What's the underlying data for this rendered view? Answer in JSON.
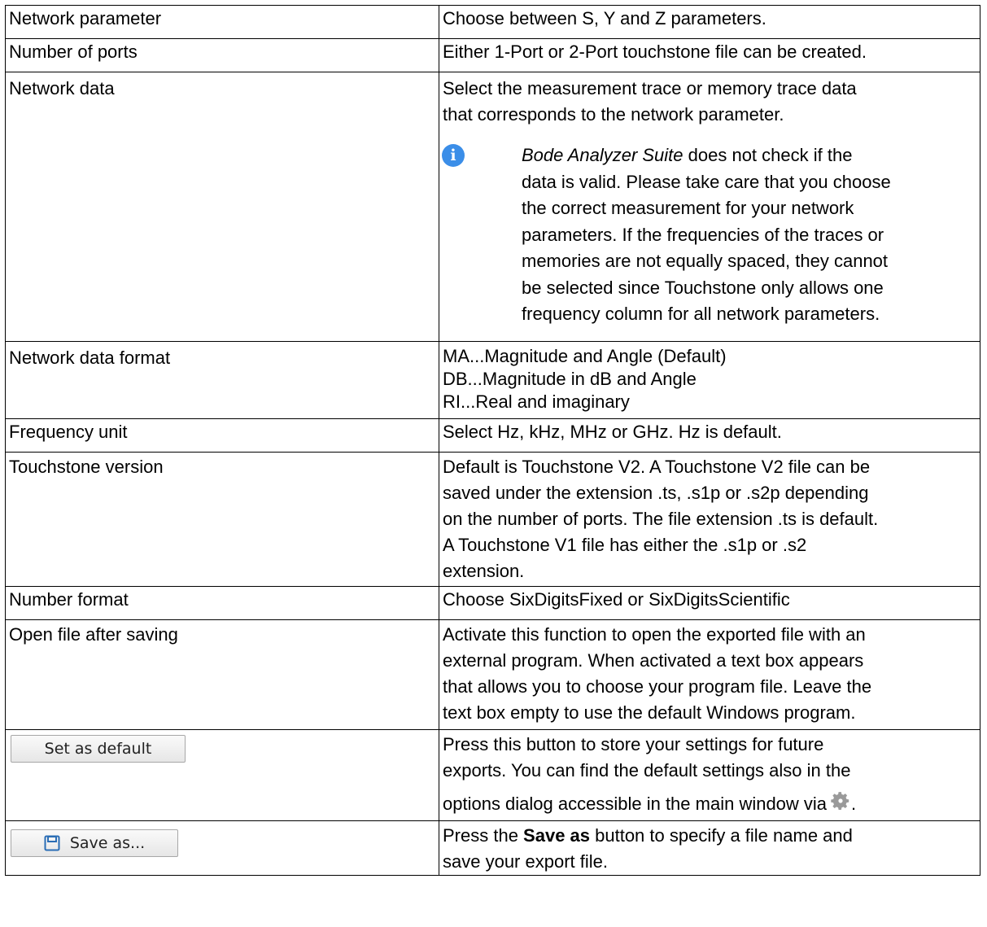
{
  "rows": [
    {
      "param": "Network parameter",
      "desc": "Choose between S, Y and Z parameters."
    },
    {
      "param": "Number of ports",
      "desc": "Either 1-Port or 2-Port touchstone file can be created."
    },
    {
      "param": "Network data",
      "desc_lines": [
        "Select the measurement trace or memory trace data",
        "that corresponds to the network parameter."
      ],
      "note": {
        "icon": "info-icon",
        "app_name": "Bode Analyzer Suite",
        "text_first": " does not check if the",
        "lines": [
          "data is valid. Please take care that you choose",
          "the correct measurement for your network",
          "parameters. If the frequencies of the traces or",
          "memories are not equally spaced, they cannot",
          "be selected since Touchstone only allows one",
          "frequency column for all network parameters."
        ]
      }
    },
    {
      "param": "Network data format",
      "desc_lines": [
        "MA...Magnitude and Angle (Default)",
        "DB...Magnitude in dB and Angle",
        "RI...Real and imaginary"
      ]
    },
    {
      "param": "Frequency unit",
      "desc": "Select Hz, kHz, MHz or GHz. Hz is default."
    },
    {
      "param": "Touchstone version",
      "desc_lines": [
        "Default is Touchstone V2. A Touchstone V2 file can be",
        "saved under the extension .ts, .s1p or .s2p depending",
        "on the number of ports. The file extension .ts is default.",
        "A Touchstone V1 file has either the .s1p or .s2",
        "extension."
      ]
    },
    {
      "param": "Number format",
      "desc": "Choose SixDigitsFixed or SixDigitsScientific"
    },
    {
      "param": "Open file after saving",
      "desc_lines": [
        "Activate this function to open the exported file with an",
        "external program. When activated a text box appears",
        "that allows you to choose your program file. Leave the",
        "text box empty to use the default Windows program."
      ]
    },
    {
      "button_label": "Set as default",
      "desc_lines": [
        "Press this button to store your settings for future",
        "exports. You can find the default settings also in the"
      ],
      "desc_last": "options dialog accessible in the main window via",
      "desc_end": ".",
      "icon": "gear-icon"
    },
    {
      "button_label": "Save as...",
      "icon": "save-icon",
      "desc_pre": "Press the ",
      "desc_bold": "Save as",
      "desc_post": " button to specify a file name and",
      "desc_line2": "save your export file."
    }
  ]
}
